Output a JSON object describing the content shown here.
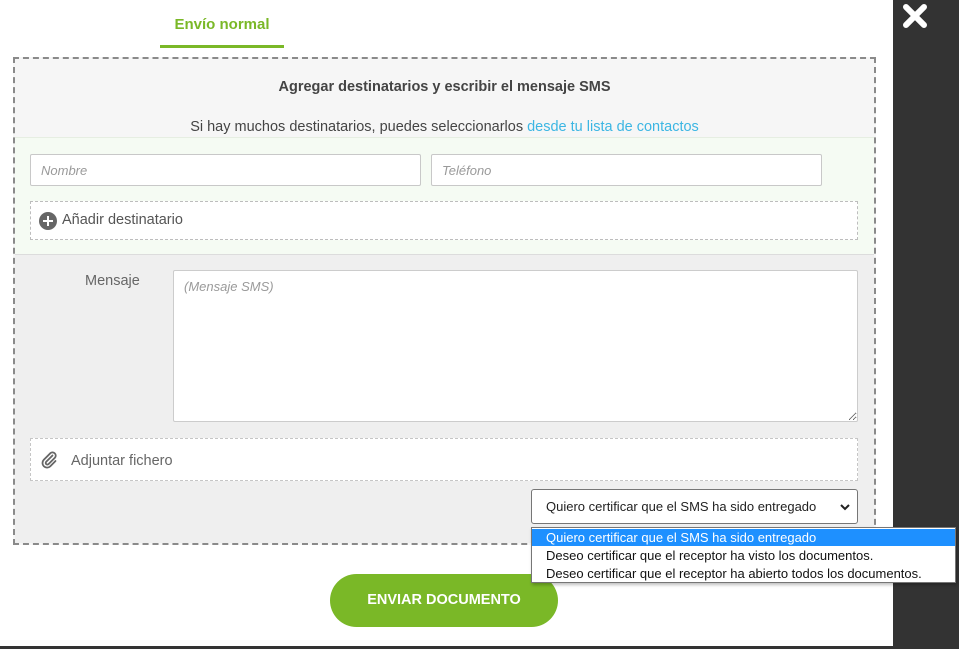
{
  "tab": {
    "label": "Envío normal"
  },
  "panel": {
    "title": "Agregar destinatarios y escribir el mensaje SMS",
    "subtitle": "Si hay muchos destinatarios, puedes seleccionarlos",
    "subtitle_link": "desde tu lista de contactos"
  },
  "recipient": {
    "name_placeholder": "Nombre",
    "phone_placeholder": "Teléfono",
    "add_label": "Añadir destinatario",
    "add_icon": "plus-circle-icon"
  },
  "message": {
    "label": "Mensaje",
    "placeholder": "(Mensaje SMS)"
  },
  "attachment": {
    "label": "Adjuntar fichero",
    "icon": "paperclip-icon"
  },
  "certification": {
    "selected": "Quiero certificar que el SMS ha sido entregado",
    "options": [
      "Quiero certificar que el SMS ha sido entregado",
      "Deseo certificar que el receptor ha visto los documentos.",
      "Deseo certificar que el receptor ha abierto todos los documentos."
    ]
  },
  "send_button": {
    "label": "ENVIAR DOCUMENTO"
  },
  "close_icon": "close-icon",
  "colors": {
    "accent_green": "#7ab827",
    "link_blue": "#3cb6e3",
    "dark_strip": "#333333",
    "selected_option": "#1e90ff"
  }
}
